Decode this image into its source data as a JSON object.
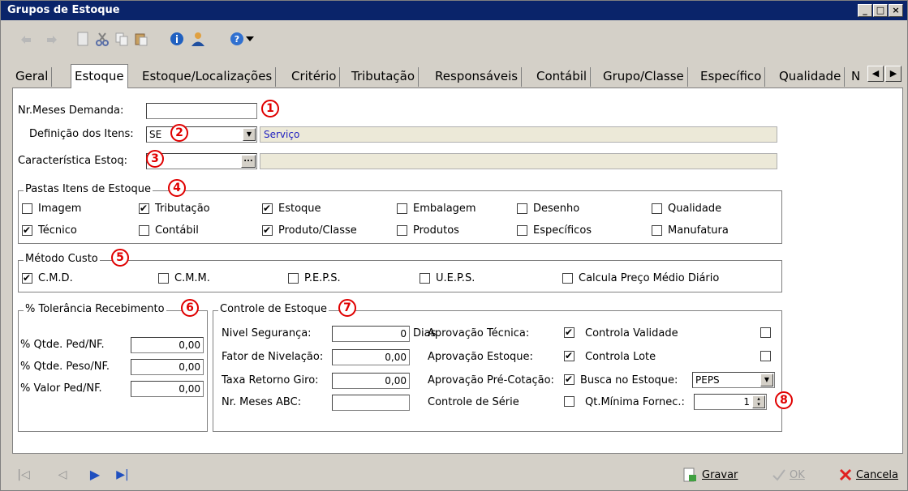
{
  "window": {
    "title": "Grupos de Estoque",
    "min": "_",
    "max": "□",
    "close": "×"
  },
  "tabs": [
    "Geral",
    "Estoque",
    "Estoque/Localizações",
    "Critério",
    "Tributação",
    "Responsáveis",
    "Contábil",
    "Grupo/Classe",
    "Específico",
    "Qualidade",
    "N"
  ],
  "tab_arrows": {
    "left": "◀",
    "right": "▶"
  },
  "form": {
    "meses_demanda_label": "Nr.Meses Demanda:",
    "meses_demanda_value": "",
    "definicao_label": "Definição dos Itens:",
    "definicao_value": "SE",
    "definicao_desc": "Serviço",
    "caracteristica_label": "Característica Estoq:",
    "caracteristica_value": "",
    "caracteristica_btn": "...",
    "dropdown_arrow": "▼"
  },
  "markers": [
    "1",
    "2",
    "3",
    "4",
    "5",
    "6",
    "7",
    "8"
  ],
  "pastas": {
    "title": "Pastas Itens de Estoque",
    "items": [
      {
        "label": "Imagem",
        "checked": false
      },
      {
        "label": "Tributação",
        "checked": true
      },
      {
        "label": "Estoque",
        "checked": true
      },
      {
        "label": "Embalagem",
        "checked": false
      },
      {
        "label": "Desenho",
        "checked": false
      },
      {
        "label": "Qualidade",
        "checked": false
      },
      {
        "label": "Técnico",
        "checked": true
      },
      {
        "label": "Contábil",
        "checked": false
      },
      {
        "label": "Produto/Classe",
        "checked": true
      },
      {
        "label": "Produtos",
        "checked": false
      },
      {
        "label": "Específicos",
        "checked": false
      },
      {
        "label": "Manufatura",
        "checked": false
      }
    ]
  },
  "metodo": {
    "title": "Método Custo",
    "items": [
      {
        "label": "C.M.D.",
        "checked": true
      },
      {
        "label": "C.M.M.",
        "checked": false
      },
      {
        "label": "P.E.P.S.",
        "checked": false
      },
      {
        "label": "U.E.P.S.",
        "checked": false
      },
      {
        "label": "Calcula Preço Médio Diário",
        "checked": false
      }
    ]
  },
  "tolerancia": {
    "title": "% Tolerância Recebimento",
    "rows": [
      {
        "label": "% Qtde. Ped/NF.",
        "value": "0,00"
      },
      {
        "label": "% Qtde. Peso/NF.",
        "value": "0,00"
      },
      {
        "label": "% Valor Ped/NF.",
        "value": "0,00"
      }
    ]
  },
  "controle": {
    "title": "Controle de Estoque",
    "nivel_label": "Nivel Segurança:",
    "nivel_value": "0",
    "nivel_unit": "Dias",
    "fator_label": "Fator de Nivelação:",
    "fator_value": "0,00",
    "taxa_label": "Taxa Retorno Giro:",
    "taxa_value": "0,00",
    "meses_abc_label": "Nr. Meses ABC:",
    "meses_abc_value": "",
    "aprov_tecnica": {
      "label": "Aprovação Técnica:",
      "checked": true
    },
    "aprov_estoque": {
      "label": "Aprovação Estoque:",
      "checked": true
    },
    "aprov_precot": {
      "label": "Aprovação Pré-Cotação:",
      "checked": true
    },
    "controle_serie": {
      "label": "Controle de Série",
      "checked": false
    },
    "controla_validade": {
      "label": "Controla Validade",
      "checked": false
    },
    "controla_lote": {
      "label": "Controla Lote",
      "checked": false
    },
    "busca_label": "Busca no Estoque:",
    "busca_value": "PEPS",
    "qt_minima_label": "Qt.Mínima Fornec.:",
    "qt_minima_value": "1"
  },
  "bottom": {
    "gravar": "Gravar",
    "ok": "OK",
    "cancela": "Cancela",
    "nav_first": "|◁",
    "nav_prev": "◁",
    "nav_next": "▶",
    "nav_last": "▶|"
  }
}
